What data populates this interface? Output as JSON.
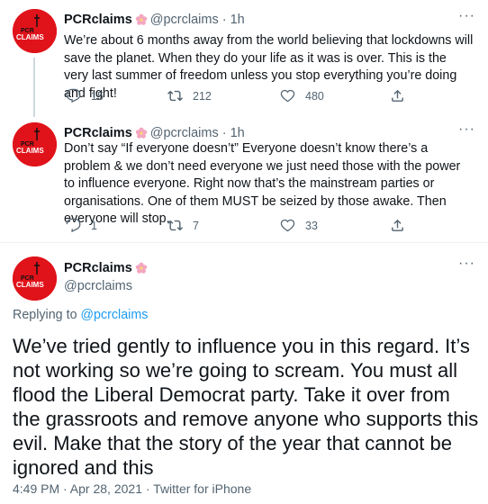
{
  "tweets": [
    {
      "display_name": "PCRclaims",
      "handle": "@pcrclaims",
      "time": "1h",
      "text": "We’re about 6 months away from the world believing that lockdowns will save the planet.  When they do your life as it was is over. This is the very last summer of freedom unless you stop everything you’re doing and fight!",
      "replies": "15",
      "retweets": "212",
      "likes": "480"
    },
    {
      "display_name": "PCRclaims",
      "handle": "@pcrclaims",
      "time": "1h",
      "text": "Don’t say “If everyone doesn’t” Everyone doesn’t know there’s a problem & we don’t need everyone we just need those with the power to influence everyone. Right now that’s the mainstream parties or organisations. One of them MUST be seized by those awake. Then everyone will stop.",
      "replies": "1",
      "retweets": "7",
      "likes": "33"
    }
  ],
  "main_tweet": {
    "display_name": "PCRclaims",
    "handle": "@pcrclaims",
    "replying_prefix": "Replying to ",
    "replying_to": "@pcrclaims",
    "text": "We’ve tried gently to influence you in this regard. It’s not working so we’re going to scream. You must all flood the Liberal Democrat party. Take it over from the grassroots and remove anyone who supports this evil. Make that the story of the year that cannot be ignored and this",
    "meta": "4:49 PM · Apr 28, 2021 · Twitter for iPhone"
  },
  "avatar": {
    "top_text": "PCR",
    "bottom_text": "CLAIMS",
    "bg": "#e0131a"
  },
  "separator": "·",
  "more_label": "···",
  "colors": {
    "secondary_text": "#536471",
    "link": "#1d9bf0",
    "divider": "#eff3f4"
  }
}
